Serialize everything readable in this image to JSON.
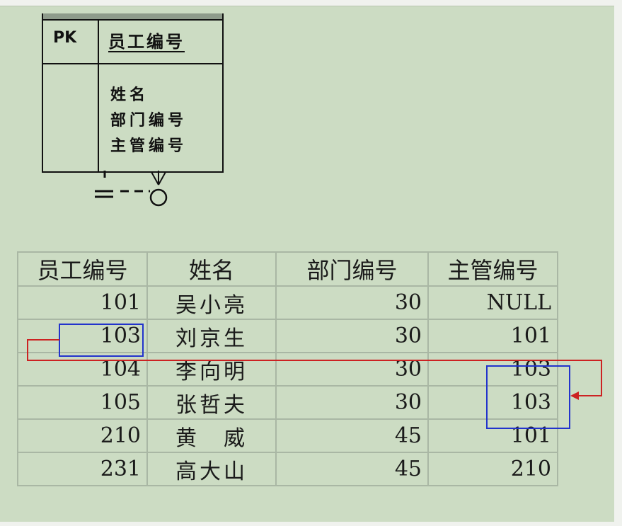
{
  "entity": {
    "pk_label": "PK",
    "primary_key": "员工编号",
    "attributes": [
      "姓名",
      "部门编号",
      "主管编号"
    ]
  },
  "table": {
    "headers": [
      "员工编号",
      "姓名",
      "部门编号",
      "主管编号"
    ],
    "rows": [
      {
        "id": "101",
        "name": "吴小亮",
        "dept": "30",
        "manager": "NULL"
      },
      {
        "id": "103",
        "name": "刘京生",
        "dept": "30",
        "manager": "101"
      },
      {
        "id": "104",
        "name": "李向明",
        "dept": "30",
        "manager": "103"
      },
      {
        "id": "105",
        "name": "张哲夫",
        "dept": "30",
        "manager": "103"
      },
      {
        "id": "210",
        "name": "黄　威",
        "dept": "45",
        "manager": "101"
      },
      {
        "id": "231",
        "name": "高大山",
        "dept": "45",
        "manager": "210"
      }
    ]
  },
  "colors": {
    "background": "#ccdcc3",
    "highlight_box": "#2233cc",
    "reference_arrow": "#cc2222"
  }
}
